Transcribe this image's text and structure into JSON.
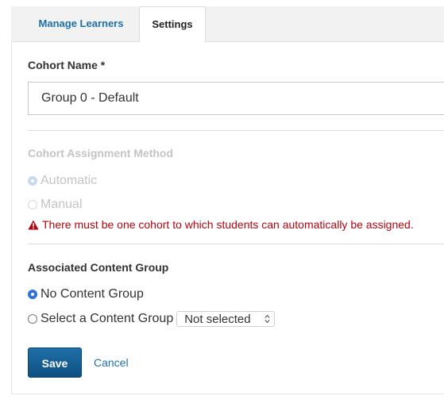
{
  "tabs": [
    {
      "label": "Manage Learners",
      "active": false
    },
    {
      "label": "Settings",
      "active": true
    }
  ],
  "cohort_name": {
    "label": "Cohort Name *",
    "value": "Group 0 - Default"
  },
  "assignment_method": {
    "label": "Cohort Assignment Method",
    "disabled": true,
    "options": [
      {
        "label": "Automatic",
        "checked": true
      },
      {
        "label": "Manual",
        "checked": false
      }
    ],
    "warning": "There must be one cohort to which students can automatically be assigned."
  },
  "content_group": {
    "label": "Associated Content Group",
    "options": [
      {
        "label": "No Content Group",
        "checked": true
      },
      {
        "label": "Select a Content Group",
        "checked": false
      }
    ],
    "select_value": "Not selected"
  },
  "actions": {
    "save_label": "Save",
    "cancel_label": "Cancel"
  },
  "colors": {
    "accent": "#1f6fa8",
    "warning": "#b20610",
    "radio_checked": "#2f73d8",
    "disabled_text": "#c4c4c4"
  },
  "icons": [
    "warning-icon",
    "select-arrows-icon"
  ]
}
